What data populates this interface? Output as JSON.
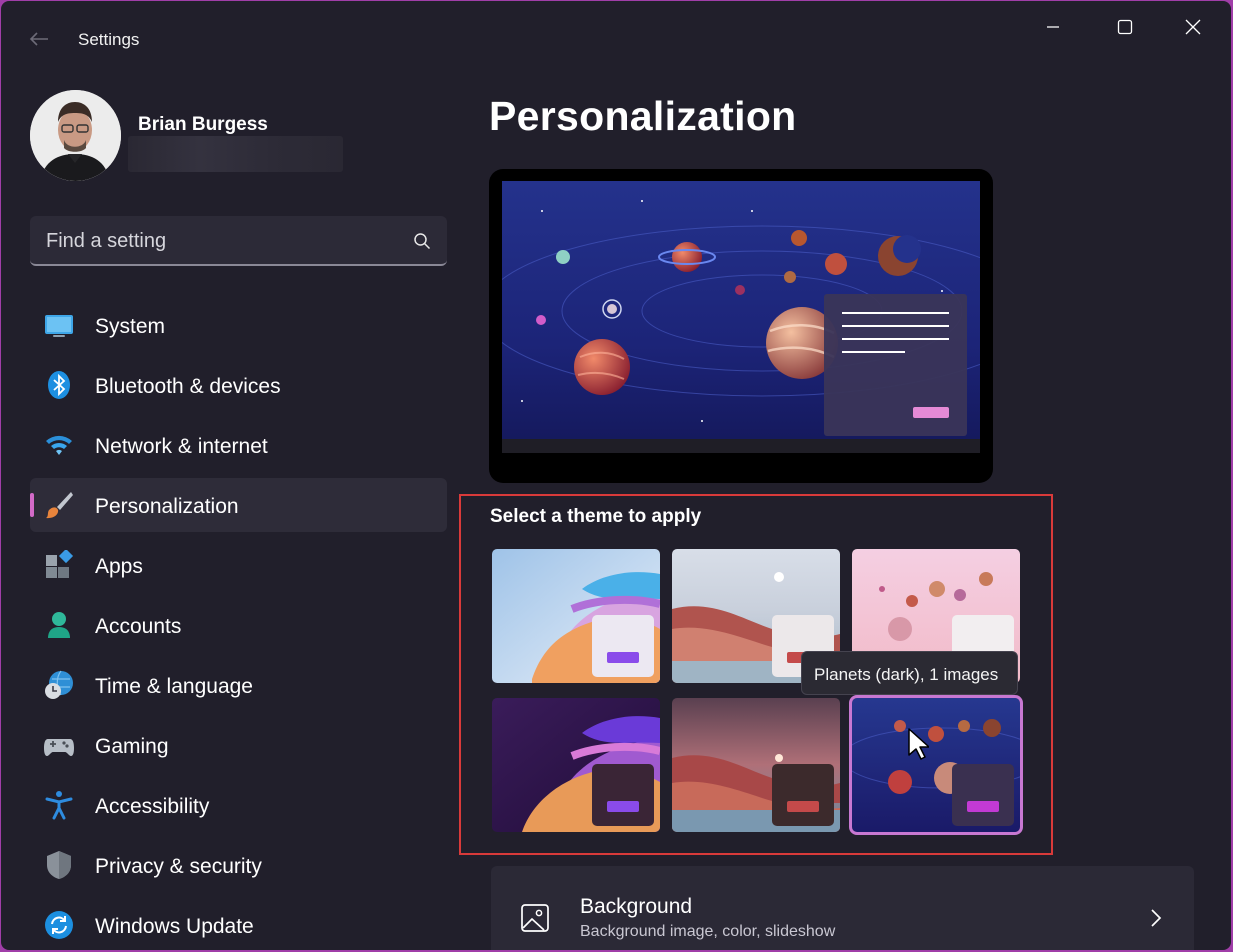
{
  "window": {
    "title": "Settings",
    "controls": [
      "minimize",
      "maximize",
      "close"
    ]
  },
  "profile": {
    "name": "Brian Burgess",
    "email": ""
  },
  "search": {
    "placeholder": "Find a setting",
    "value": ""
  },
  "nav": {
    "items": [
      {
        "label": "System",
        "icon": "system-icon"
      },
      {
        "label": "Bluetooth & devices",
        "icon": "bluetooth-icon"
      },
      {
        "label": "Network & internet",
        "icon": "wifi-icon"
      },
      {
        "label": "Personalization",
        "icon": "brush-icon",
        "active": true
      },
      {
        "label": "Apps",
        "icon": "apps-icon"
      },
      {
        "label": "Accounts",
        "icon": "person-icon"
      },
      {
        "label": "Time & language",
        "icon": "globe-clock-icon"
      },
      {
        "label": "Gaming",
        "icon": "controller-icon"
      },
      {
        "label": "Accessibility",
        "icon": "accessibility-icon"
      },
      {
        "label": "Privacy & security",
        "icon": "shield-icon"
      },
      {
        "label": "Windows Update",
        "icon": "update-icon"
      }
    ]
  },
  "main": {
    "title": "Personalization",
    "theme_heading": "Select a theme to apply",
    "tooltip": "Planets (dark), 1 images",
    "themes": [
      {
        "name": "windows-light",
        "accent": "#8a4bea"
      },
      {
        "name": "glow-light",
        "accent": "#c44a4a"
      },
      {
        "name": "planets-light",
        "accent": "#d25cc9"
      },
      {
        "name": "windows-dark",
        "accent": "#8a4bea"
      },
      {
        "name": "glow-dark",
        "accent": "#c44a4a"
      },
      {
        "name": "planets-dark",
        "accent": "#c23ad4",
        "selected": true
      }
    ],
    "background_row": {
      "title": "Background",
      "subtitle": "Background image, color, slideshow"
    }
  },
  "colors": {
    "window_bg": "#211f2b",
    "accent": "#d36ac8",
    "highlight_border": "#d93a3a"
  }
}
